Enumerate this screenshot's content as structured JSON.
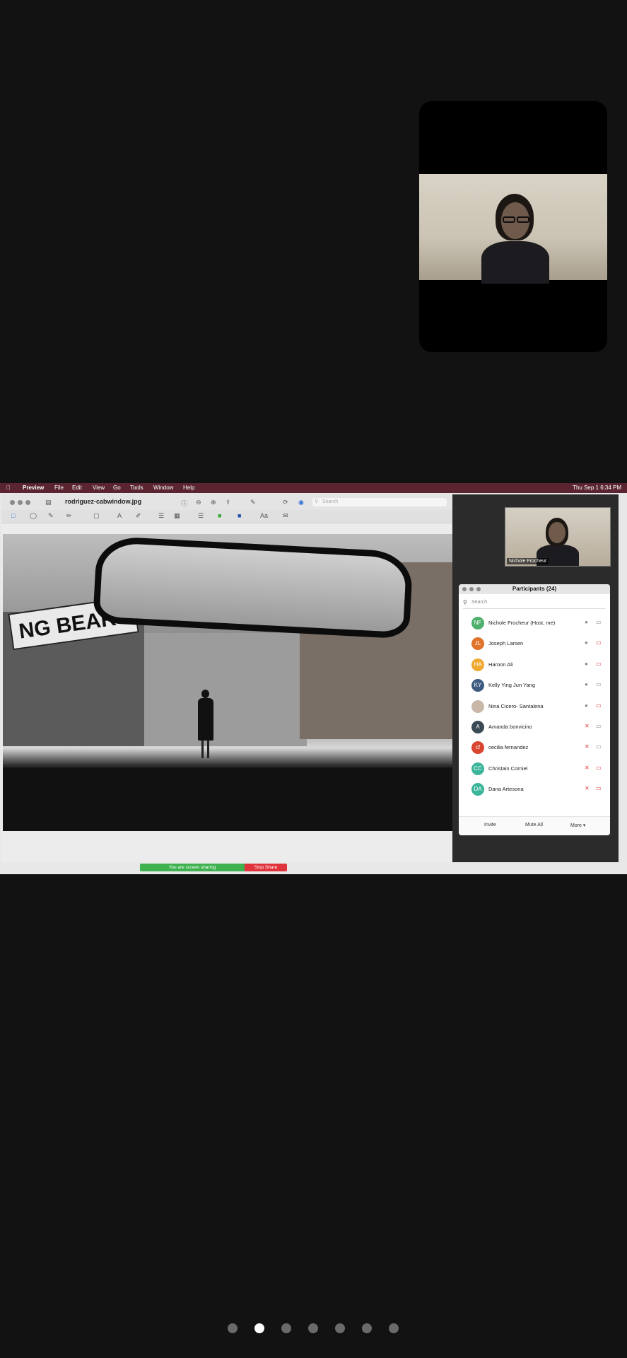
{
  "menubar": {
    "items": [
      "Preview",
      "File",
      "Edit",
      "View",
      "Go",
      "Tools",
      "Window",
      "Help"
    ],
    "clock": "Thu Sep 1  6:34 PM"
  },
  "preview": {
    "title": "rodriguez-cabwindow.jpg",
    "search_placeholder": "Search",
    "sign_text": "NG BEAR"
  },
  "self_video": {
    "label": "Nichole Frocheur"
  },
  "participants": {
    "title": "Participants (24)",
    "search_placeholder": "Search",
    "rows": [
      {
        "initials": "NF",
        "name": "Nichole Frocheur (Host, me)",
        "color": "#4caf6a",
        "muted": false,
        "video_off": false
      },
      {
        "initials": "JL",
        "name": "Joseph Larsen",
        "color": "#e0742a",
        "muted": false,
        "video_off": true
      },
      {
        "initials": "HA",
        "name": "Haroon Ali",
        "color": "#f0a830",
        "muted": false,
        "video_off": true
      },
      {
        "initials": "KY",
        "name": "Kelly Ying Jun Yang",
        "color": "#3d5a80",
        "muted": false,
        "video_off": false
      },
      {
        "initials": "",
        "name": "Nina Cicero- Santalena",
        "color": "#c9b8a8",
        "muted": false,
        "video_off": true
      },
      {
        "initials": "A",
        "name": "Amanda bonvicino",
        "color": "#3a4a55",
        "muted": true,
        "video_off": false
      },
      {
        "initials": "cf",
        "name": "cecilia fernandez",
        "color": "#d9452f",
        "muted": true,
        "video_off": false
      },
      {
        "initials": "CC",
        "name": "Christain Corniel",
        "color": "#3bb59a",
        "muted": true,
        "video_off": true
      },
      {
        "initials": "DA",
        "name": "Dana Artesona",
        "color": "#3bb59a",
        "muted": true,
        "video_off": true
      }
    ],
    "buttons": {
      "invite": "Invite",
      "mute_all": "Mute All",
      "more": "More ▾"
    }
  },
  "share_bar": {
    "status": "You are screen sharing",
    "stop": "Stop Share"
  },
  "pager": {
    "count": 7,
    "active": 1
  },
  "colors": {
    "menubar": "#5a2531",
    "sharing_green": "#3fb24f",
    "stop_red": "#e0343c"
  }
}
